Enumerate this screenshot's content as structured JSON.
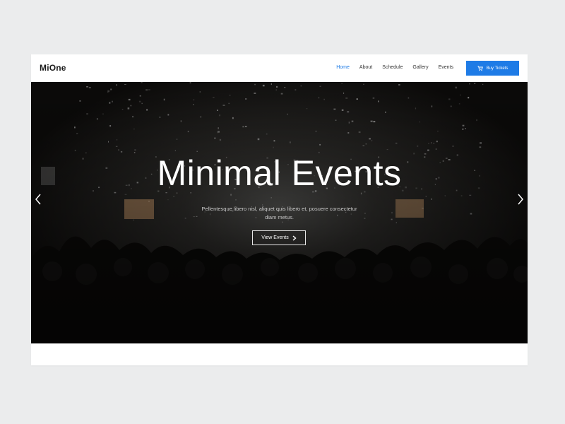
{
  "navbar": {
    "logo": "MiOne",
    "links": [
      "Home",
      "About",
      "Schedule",
      "Gallery",
      "Events"
    ],
    "active_link": "Home",
    "buy_button": {
      "label": "Buy Tickets",
      "icon": "cart-icon"
    }
  },
  "hero": {
    "title": "Minimal Events",
    "subtitle": "Pellentesque libero nisl, aliquet quis libero et, posuere consectetur diam metus.",
    "cta_label": "View Events",
    "cta_icon": "chevron-right-icon",
    "prev_icon": "chevron-left-icon",
    "next_icon": "chevron-right-icon"
  },
  "colors": {
    "accent": "#1e7be6",
    "page_background": "#ebeced",
    "hero_dark": "#0c0b0a"
  }
}
